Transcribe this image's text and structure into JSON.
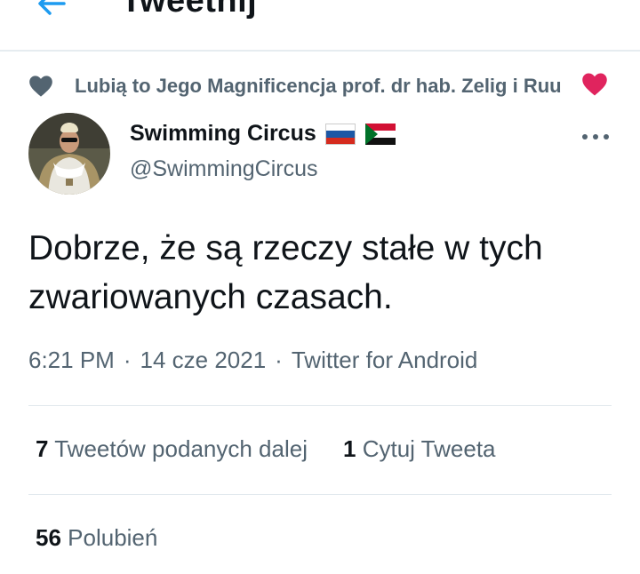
{
  "header": {
    "title": "Tweetnij",
    "back_icon": "arrow-left-icon",
    "accent": "#1d9bf0"
  },
  "social_context": {
    "text": "Lubią to Jego Magnificencja prof. dr hab. Zelig i Ruu",
    "icons": [
      "heart-icon",
      "red-heart-emoji"
    ]
  },
  "author": {
    "display_name": "Swimming Circus",
    "handle": "@SwimmingCircus",
    "flags": [
      "russia-flag",
      "sudan-flag"
    ]
  },
  "tweet": {
    "text": "Dobrze, że są rzeczy stałe w tych zwariowanych czasach.",
    "time": "6:21 PM",
    "date": "14 cze 2021",
    "client": "Twitter for Android",
    "separator": "·"
  },
  "stats": {
    "retweets_count": "7",
    "retweets_label": "Tweetów podanych dalej",
    "quotes_count": "1",
    "quotes_label": "Cytuj Tweeta",
    "likes_count": "56",
    "likes_label": "Polubień"
  },
  "colors": {
    "secondary_text": "#536471",
    "heart_red": "#e0245e",
    "heart_gray": "#536471"
  }
}
